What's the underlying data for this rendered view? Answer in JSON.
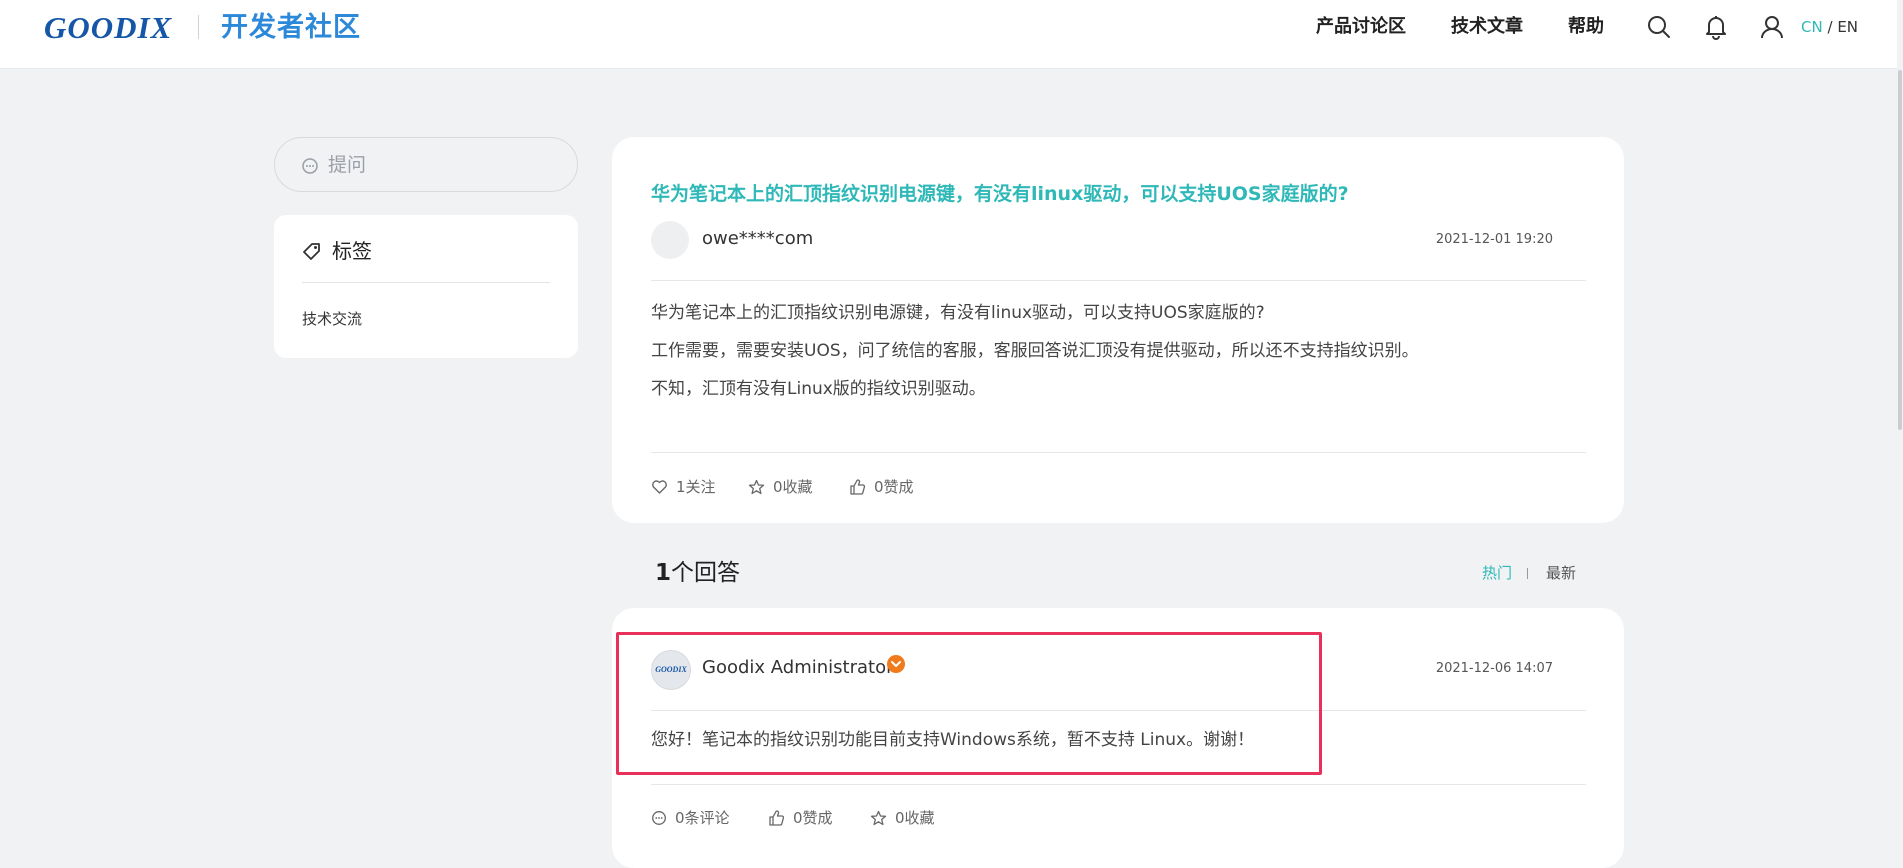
{
  "header": {
    "logo_text": "GOODIX",
    "site_name": "开发者社区",
    "nav": [
      "产品讨论区",
      "技术文章",
      "帮助"
    ],
    "lang_cn": "CN",
    "lang_sep": "/",
    "lang_en": "EN",
    "icons": [
      "search-icon",
      "bell-icon",
      "user-icon"
    ]
  },
  "sidebar": {
    "ask_label": "提问",
    "tags_title": "标签",
    "tags": [
      "技术交流"
    ]
  },
  "question": {
    "title": "华为笔记本上的汇顶指纹识别电源键，有没有linux驱动，可以支持UOS家庭版的?",
    "author": "owe****com",
    "date": "2021-12-01 19:20",
    "body": [
      "华为笔记本上的汇顶指纹识别电源键，有没有linux驱动，可以支持UOS家庭版的?",
      "工作需要，需要安装UOS，问了统信的客服，客服回答说汇顶没有提供驱动，所以还不支持指纹识别。",
      "不知，汇顶有没有Linux版的指纹识别驱动。"
    ],
    "follow": "1关注",
    "favorite": "0收藏",
    "like": "0赞成"
  },
  "answers": {
    "count": "1",
    "count_suffix": "个回答",
    "sort_hot": "热门",
    "sort_new": "最新",
    "items": [
      {
        "avatar_text": "GOODIX",
        "author": "Goodix Administrator",
        "date": "2021-12-06 14:07",
        "body": "您好！笔记本的指纹识别功能目前支持Windows系统，暂不支持 Linux。谢谢！",
        "comments": "0条评论",
        "like": "0赞成",
        "favorite": "0收藏"
      }
    ]
  },
  "colors": {
    "accent": "#2fb8b8",
    "brand": "#1556a6",
    "highlight": "#e8305a",
    "badge": "#f07b1b"
  }
}
